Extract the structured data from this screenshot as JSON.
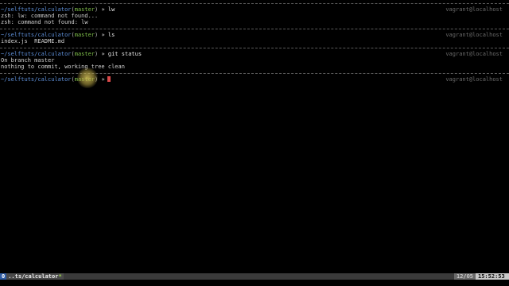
{
  "prompt": {
    "path": "~/selftuts/calculator",
    "branch": "master",
    "arrow": "»",
    "host": "vagrant@localhost"
  },
  "blocks": [
    {
      "command": "lw",
      "output": [
        "zsh: lw: command not found...",
        "zsh: command not found: lw"
      ]
    },
    {
      "command": "ls",
      "output": [
        "index.js  README.md"
      ]
    },
    {
      "command": "git status",
      "output": [
        "On branch master",
        "nothing to commit, working tree clean"
      ]
    }
  ],
  "statusbar": {
    "window_index": "0",
    "window_title": "..ts/calculator",
    "window_flag": "*",
    "date": "12/05",
    "time": "15:52:53"
  },
  "colors": {
    "background": "#000000",
    "path": "#5e8fd8",
    "branch": "#7fbf4a",
    "cursor": "#d94a4a",
    "host": "#6a6a6a"
  }
}
